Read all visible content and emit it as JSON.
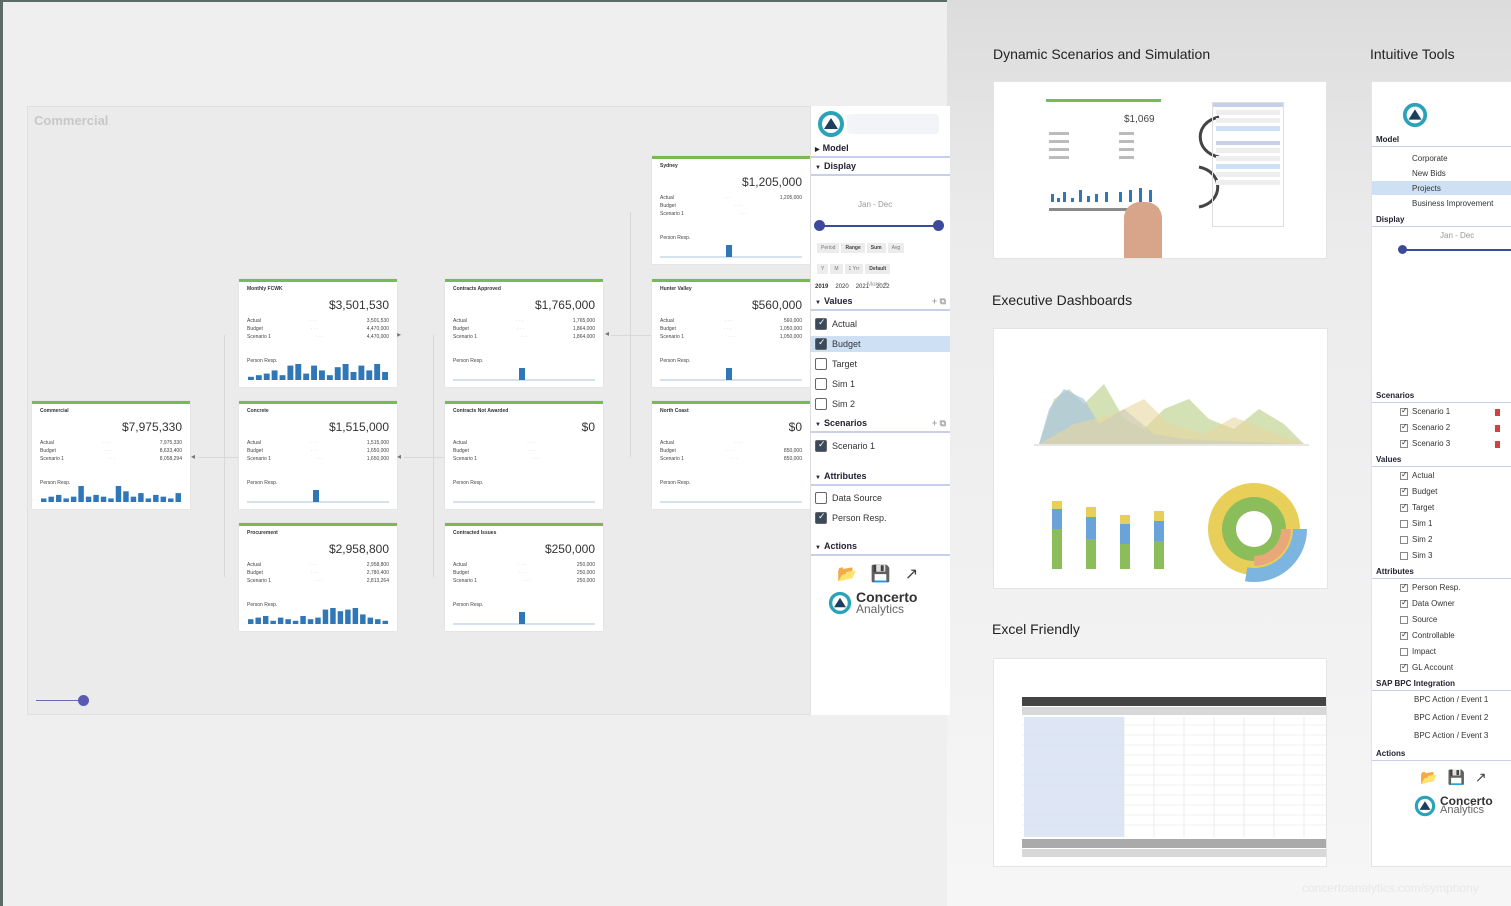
{
  "app": {
    "title": "Commercial",
    "tiles": [
      {
        "id": "commercial",
        "name": "Commercial",
        "value": "$7,975,330",
        "rows": [
          [
            "Actual",
            "7,975,330"
          ],
          [
            "Budget",
            "8,633,400"
          ],
          [
            "Scenario 1",
            "8,058,294"
          ]
        ],
        "bars": [
          2,
          3,
          4,
          2,
          3,
          9,
          3,
          4,
          3,
          2,
          9,
          6,
          3,
          5,
          2,
          4,
          3,
          2,
          5
        ]
      },
      {
        "id": "monthly-fcwk",
        "name": "Monthly FCWK",
        "value": "$3,501,530",
        "rows": [
          [
            "Actual",
            "3,501,530"
          ],
          [
            "Budget",
            "4,470,000"
          ],
          [
            "Scenario 1",
            "4,470,000"
          ]
        ],
        "bars": [
          2,
          3,
          4,
          6,
          3,
          9,
          10,
          4,
          9,
          6,
          3,
          8,
          10,
          5,
          9,
          6,
          10,
          5
        ]
      },
      {
        "id": "contracts-approved",
        "name": "Contracts Approved",
        "value": "$1,765,000",
        "rows": [
          [
            "Actual",
            "1,765,000"
          ],
          [
            "Budget",
            "1,864,000"
          ],
          [
            "Scenario 1",
            "1,864,000"
          ]
        ],
        "bars": []
      },
      {
        "id": "sydney",
        "name": "Sydney",
        "value": "$1,205,000",
        "rows": [
          [
            "Actual",
            "1,205,000"
          ],
          [
            "Budget",
            ""
          ],
          [
            "Scenario 1",
            ""
          ]
        ],
        "bars": []
      },
      {
        "id": "hunter-valley",
        "name": "Hunter Valley",
        "value": "$560,000",
        "rows": [
          [
            "Actual",
            "560,000"
          ],
          [
            "Budget",
            "1,050,000"
          ],
          [
            "Scenario 1",
            "1,050,000"
          ]
        ],
        "bars": []
      },
      {
        "id": "concrete",
        "name": "Concrete",
        "value": "$1,515,000",
        "rows": [
          [
            "Actual",
            "1,515,000"
          ],
          [
            "Budget",
            "1,650,000"
          ],
          [
            "Scenario 1",
            "1,650,000"
          ]
        ],
        "bars": []
      },
      {
        "id": "contracts-non-awarded",
        "name": "Contracts Not Awarded",
        "value": "$0",
        "rows": [
          [
            "Actual",
            ""
          ],
          [
            "Budget",
            ""
          ],
          [
            "Scenario 1",
            ""
          ]
        ],
        "bars": []
      },
      {
        "id": "north-coast",
        "name": "North Coast",
        "value": "$0",
        "rows": [
          [
            "Actual",
            ""
          ],
          [
            "Budget",
            "850,000"
          ],
          [
            "Scenario 1",
            "850,000"
          ]
        ],
        "bars": []
      },
      {
        "id": "procurement",
        "name": "Procurement",
        "value": "$2,958,800",
        "rows": [
          [
            "Actual",
            "2,958,800"
          ],
          [
            "Budget",
            "2,780,400"
          ],
          [
            "Scenario 1",
            "2,813,264"
          ]
        ],
        "bars": [
          3,
          4,
          5,
          2,
          4,
          3,
          2,
          5,
          3,
          4,
          9,
          10,
          8,
          9,
          10,
          6,
          4,
          3,
          2
        ]
      },
      {
        "id": "contracted-issues",
        "name": "Contracted Issues",
        "value": "$250,000",
        "rows": [
          [
            "Actual",
            "250,000"
          ],
          [
            "Budget",
            "250,000"
          ],
          [
            "Scenario 1",
            "250,000"
          ]
        ],
        "bars": []
      }
    ],
    "person_resp": "Person Resp."
  },
  "panel": {
    "model": "Model",
    "display": "Display",
    "years": [
      "2019",
      "2020",
      "2021",
      "2022"
    ],
    "range": "Jan - Dec",
    "buttons1": [
      "Period",
      "Range",
      "Sum",
      "Avg"
    ],
    "buttons2": [
      "Y",
      "M",
      "1 Yrr",
      "Default"
    ],
    "more": "More ▼",
    "values": "Values",
    "value_items": [
      {
        "label": "Actual",
        "checked": true
      },
      {
        "label": "Budget",
        "checked": true,
        "selected": true
      },
      {
        "label": "Target",
        "checked": false
      },
      {
        "label": "Sim 1",
        "checked": false
      },
      {
        "label": "Sim 2",
        "checked": false
      }
    ],
    "scenarios": "Scenarios",
    "scenario_items": [
      {
        "label": "Scenario 1",
        "checked": true
      }
    ],
    "attributes": "Attributes",
    "attribute_items": [
      {
        "label": "Data Source",
        "checked": false
      },
      {
        "label": "Person Resp.",
        "checked": true
      }
    ],
    "actions": "Actions",
    "brand1": "Concerto",
    "brand2": "Analytics"
  },
  "right": {
    "scenarios_title": "Dynamic Scenarios and Simulation",
    "scenario_preview_value": "$1,069",
    "dashboards_title": "Executive Dashboards",
    "excel_title": "Excel Friendly",
    "tools_title": "Intuitive Tools",
    "tools": {
      "model": "Model",
      "model_items": [
        "Corporate",
        "New Bids",
        "Projects",
        "Business Improvement"
      ],
      "display": "Display",
      "range": "Jan - Dec",
      "scenarios": "Scenarios",
      "scenario_items": [
        "Scenario 1",
        "Scenario 2",
        "Scenario 3"
      ],
      "values": "Values",
      "value_items": [
        {
          "label": "Actual",
          "checked": true
        },
        {
          "label": "Budget",
          "checked": true
        },
        {
          "label": "Target",
          "checked": true
        },
        {
          "label": "Sim 1",
          "checked": false
        },
        {
          "label": "Sim 2",
          "checked": false
        },
        {
          "label": "Sim 3",
          "checked": false
        }
      ],
      "attributes": "Attributes",
      "attribute_items": [
        {
          "label": "Person Resp.",
          "checked": true
        },
        {
          "label": "Data Owner",
          "checked": true
        },
        {
          "label": "Source",
          "checked": false
        },
        {
          "label": "Controllable",
          "checked": true
        },
        {
          "label": "Impact",
          "checked": false
        },
        {
          "label": "GL Account",
          "checked": true
        }
      ],
      "sap": "SAP BPC Integration",
      "sap_items": [
        "BPC Action / Event 1",
        "BPC Action / Event 2",
        "BPC Action / Event 3"
      ],
      "actions": "Actions",
      "brand1": "Concerto",
      "brand2": "Analytics"
    },
    "footer": "concertoanalytics.com/symphony"
  },
  "colors": {
    "accent_green": "#7bb954",
    "bar_blue": "#2f77b6",
    "slider": "#3d4a9a",
    "logo_teal": "#2aa3b8"
  }
}
